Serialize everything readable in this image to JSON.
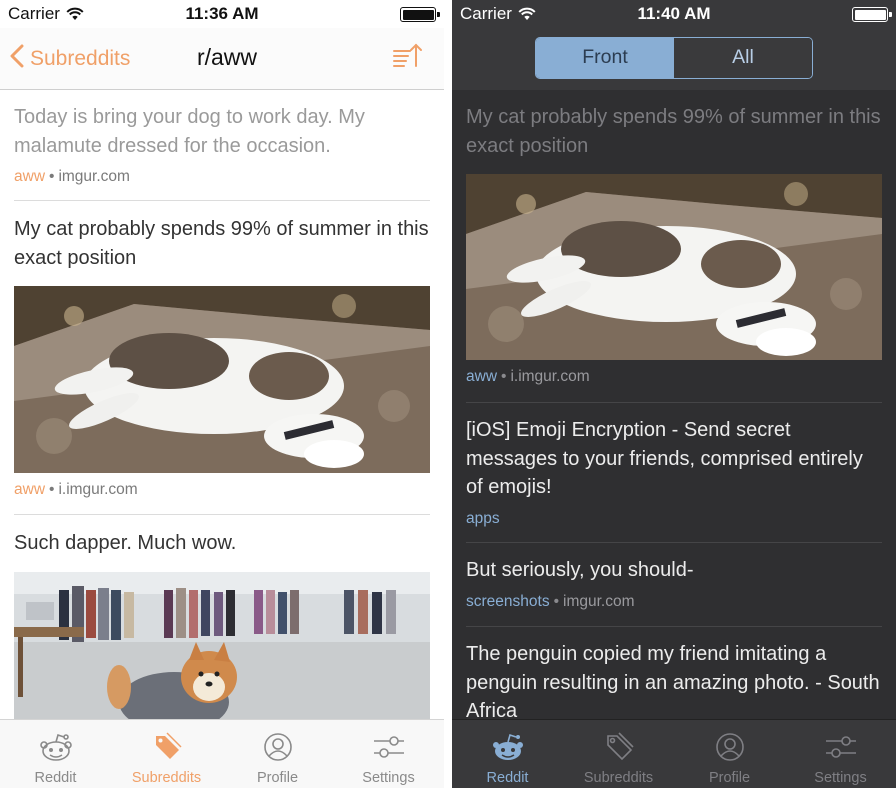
{
  "light": {
    "status": {
      "carrier": "Carrier",
      "time": "11:36 AM"
    },
    "nav": {
      "back_label": "Subreddits",
      "title": "r/aww"
    },
    "posts": [
      {
        "title": "Today is bring your dog to work day. My malamute dressed for the occasion.",
        "subreddit": "aww",
        "domain": "imgur.com"
      },
      {
        "title": "My cat probably spends 99% of summer in this exact position",
        "subreddit": "aww",
        "domain": "i.imgur.com"
      },
      {
        "title": "Such dapper. Much wow."
      }
    ],
    "tabs": [
      {
        "label": "Reddit",
        "icon": "reddit-alien-icon"
      },
      {
        "label": "Subreddits",
        "icon": "tag-icon"
      },
      {
        "label": "Profile",
        "icon": "profile-icon"
      },
      {
        "label": "Settings",
        "icon": "sliders-icon"
      }
    ],
    "active_tab": "Subreddits",
    "colors": {
      "accent": "#f0a068"
    }
  },
  "dark": {
    "status": {
      "carrier": "Carrier",
      "time": "11:40 AM"
    },
    "segment": {
      "options": [
        "Front",
        "All"
      ],
      "selected": "Front"
    },
    "posts": [
      {
        "title": "My cat probably spends 99% of summer in this exact position",
        "subreddit": "aww",
        "domain": "i.imgur.com"
      },
      {
        "title": "[iOS] Emoji Encryption - Send secret messages to your friends, comprised entirely of emojis!",
        "subreddit": "apps"
      },
      {
        "title": "But seriously, you should-",
        "subreddit": "screenshots",
        "domain": "imgur.com"
      },
      {
        "title": "The penguin copied my friend imitating a penguin resulting in an amazing photo. - South Africa"
      }
    ],
    "tabs": [
      {
        "label": "Reddit",
        "icon": "reddit-alien-icon"
      },
      {
        "label": "Subreddits",
        "icon": "tag-icon"
      },
      {
        "label": "Profile",
        "icon": "profile-icon"
      },
      {
        "label": "Settings",
        "icon": "sliders-icon"
      }
    ],
    "active_tab": "Reddit",
    "colors": {
      "accent": "#89aed4",
      "background": "#2f2f31"
    }
  }
}
